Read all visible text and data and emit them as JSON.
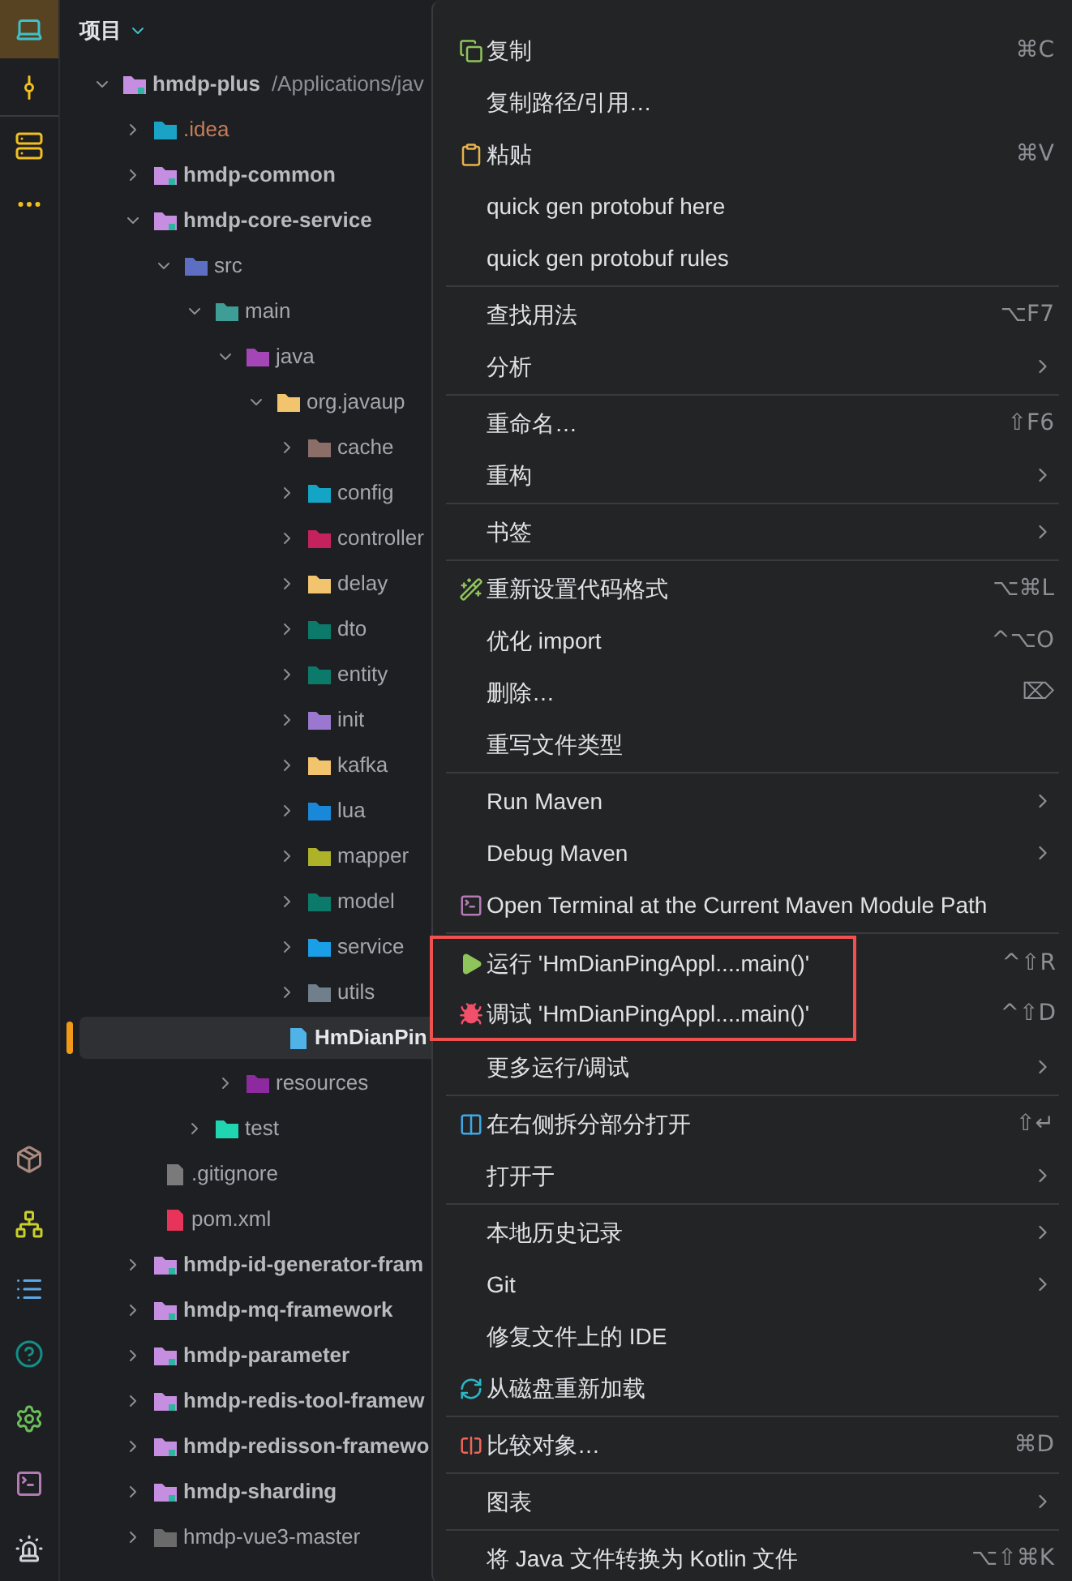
{
  "panel": {
    "title": "项目"
  },
  "tree": [
    {
      "label": "hmdp-plus",
      "path": "/Applications/jav",
      "kind": "module",
      "color": "#c58ee0",
      "expanded": true,
      "children": [
        {
          "label": ".idea",
          "kind": "folder",
          "color": "#1aa3c4",
          "expanded": false,
          "excluded": true
        },
        {
          "label": "hmdp-common",
          "kind": "module",
          "color": "#c58ee0",
          "expanded": false
        },
        {
          "label": "hmdp-core-service",
          "kind": "module",
          "color": "#c58ee0",
          "expanded": true,
          "children": [
            {
              "label": "src",
              "kind": "folder",
              "color": "#5c6fc2",
              "expanded": true,
              "children": [
                {
                  "label": "main",
                  "kind": "folder",
                  "color": "#3e9e95",
                  "expanded": true,
                  "children": [
                    {
                      "label": "java",
                      "kind": "folder",
                      "color": "#a446b5",
                      "expanded": true,
                      "children": [
                        {
                          "label": "org.javaup",
                          "kind": "folder",
                          "color": "#f2c46d",
                          "expanded": true,
                          "children": [
                            {
                              "label": "cache",
                              "kind": "folder",
                              "color": "#8c6e68",
                              "expanded": false
                            },
                            {
                              "label": "config",
                              "kind": "folder",
                              "color": "#14a4c6",
                              "expanded": false
                            },
                            {
                              "label": "controller",
                              "kind": "folder",
                              "color": "#c5215d",
                              "expanded": false
                            },
                            {
                              "label": "delay",
                              "kind": "folder",
                              "color": "#f2c46d",
                              "expanded": false
                            },
                            {
                              "label": "dto",
                              "kind": "folder",
                              "color": "#0b7a6a",
                              "expanded": false
                            },
                            {
                              "label": "entity",
                              "kind": "folder",
                              "color": "#0b7a6a",
                              "expanded": false
                            },
                            {
                              "label": "init",
                              "kind": "folder",
                              "color": "#9a78d0",
                              "expanded": false
                            },
                            {
                              "label": "kafka",
                              "kind": "folder",
                              "color": "#f2c46d",
                              "expanded": false
                            },
                            {
                              "label": "lua",
                              "kind": "folder",
                              "color": "#1a88d8",
                              "expanded": false
                            },
                            {
                              "label": "mapper",
                              "kind": "folder",
                              "color": "#aeb229",
                              "expanded": false
                            },
                            {
                              "label": "model",
                              "kind": "folder",
                              "color": "#0b7a6a",
                              "expanded": false
                            },
                            {
                              "label": "service",
                              "kind": "folder",
                              "color": "#1a9ee8",
                              "expanded": false
                            },
                            {
                              "label": "utils",
                              "kind": "folder",
                              "color": "#6f7f8c",
                              "expanded": false
                            },
                            {
                              "label": "HmDianPin",
                              "kind": "file",
                              "color": "#4fb3e8",
                              "selected": true
                            }
                          ]
                        }
                      ]
                    },
                    {
                      "label": "resources",
                      "kind": "folder",
                      "color": "#8d2aa0",
                      "expanded": false
                    }
                  ]
                },
                {
                  "label": "test",
                  "kind": "folder",
                  "color": "#1fd6b0",
                  "expanded": false
                }
              ]
            },
            {
              "label": ".gitignore",
              "kind": "file",
              "color": "#7a7a7a",
              "selected": false
            },
            {
              "label": "pom.xml",
              "kind": "file",
              "color": "#e8335a",
              "selected": false
            }
          ]
        },
        {
          "label": "hmdp-id-generator-fram",
          "kind": "module",
          "color": "#c58ee0",
          "expanded": false
        },
        {
          "label": "hmdp-mq-framework",
          "kind": "module",
          "color": "#c58ee0",
          "expanded": false
        },
        {
          "label": "hmdp-parameter",
          "kind": "module",
          "color": "#c58ee0",
          "expanded": false
        },
        {
          "label": "hmdp-redis-tool-framew",
          "kind": "module",
          "color": "#c58ee0",
          "expanded": false
        },
        {
          "label": "hmdp-redisson-framewo",
          "kind": "module",
          "color": "#c58ee0",
          "expanded": false
        },
        {
          "label": "hmdp-sharding",
          "kind": "module",
          "color": "#c58ee0",
          "expanded": false
        },
        {
          "label": "hmdp-vue3-master",
          "kind": "folder",
          "color": "#6a6a6a",
          "expanded": false
        }
      ]
    }
  ],
  "context_menu": {
    "sections": [
      {
        "items": [
          {
            "label": "复制",
            "shortcut": "⌘C"
          },
          {
            "label": "复制路径/引用…"
          },
          {
            "label": "粘贴",
            "shortcut": "⌘V"
          },
          {
            "label": "quick gen protobuf here"
          },
          {
            "label": "quick gen protobuf rules"
          }
        ]
      },
      {
        "items": [
          {
            "label": "查找用法",
            "shortcut": "⌥F7"
          },
          {
            "label": "分析",
            "submenu": true
          }
        ]
      },
      {
        "items": [
          {
            "label": "重命名…",
            "shortcut": "⇧F6"
          },
          {
            "label": "重构",
            "submenu": true
          }
        ]
      },
      {
        "items": [
          {
            "label": "书签",
            "submenu": true
          }
        ]
      },
      {
        "items": [
          {
            "label": "重新设置代码格式",
            "shortcut": "⌥⌘L"
          },
          {
            "label": "优化 import",
            "shortcut": "^⌥O"
          },
          {
            "label": "删除…",
            "shortcut": "⌦"
          },
          {
            "label": "重写文件类型"
          }
        ]
      },
      {
        "items": [
          {
            "label": "Run Maven",
            "submenu": true
          },
          {
            "label": "Debug Maven",
            "submenu": true
          },
          {
            "label": "Open Terminal at the Current Maven Module Path"
          }
        ]
      },
      {
        "items": [
          {
            "label": "运行 'HmDianPingAppl....main()'",
            "shortcut": "^⇧R",
            "outlined": true
          },
          {
            "label": "调试 'HmDianPingAppl....main()'",
            "shortcut": "^⇧D",
            "outlined": true
          },
          {
            "label": "更多运行/调试",
            "submenu": true
          }
        ]
      },
      {
        "items": [
          {
            "label": "在右侧拆分部分打开",
            "shortcut": "⇧↵"
          },
          {
            "label": "打开于",
            "submenu": true
          }
        ]
      },
      {
        "items": [
          {
            "label": "本地历史记录",
            "submenu": true
          },
          {
            "label": "Git",
            "submenu": true
          },
          {
            "label": "修复文件上的 IDE"
          },
          {
            "label": "从磁盘重新加载"
          }
        ]
      },
      {
        "items": [
          {
            "label": "比较对象…",
            "shortcut": "⌘D"
          }
        ]
      },
      {
        "items": [
          {
            "label": "图表",
            "submenu": true
          }
        ]
      },
      {
        "items": [
          {
            "label": "将 Java 文件转换为 Kotlin 文件",
            "shortcut": "⌥⇧⌘K"
          }
        ]
      }
    ]
  }
}
